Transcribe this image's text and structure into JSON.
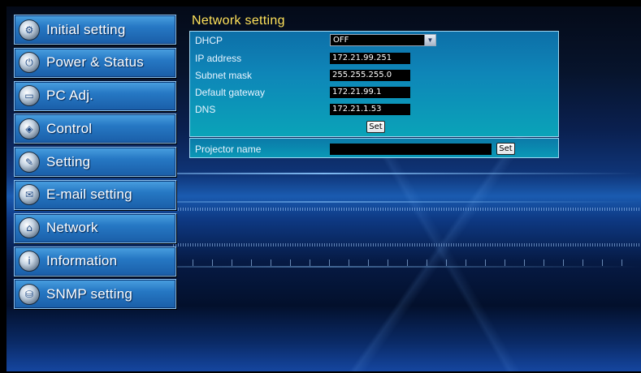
{
  "sidebar": {
    "items": [
      {
        "label": "Initial setting",
        "icon": "initial-setting-icon"
      },
      {
        "label": "Power & Status",
        "icon": "power-status-icon"
      },
      {
        "label": "PC Adj.",
        "icon": "pc-adj-icon"
      },
      {
        "label": "Control",
        "icon": "control-icon"
      },
      {
        "label": "Setting",
        "icon": "setting-icon"
      },
      {
        "label": "E-mail setting",
        "icon": "email-icon"
      },
      {
        "label": "Network",
        "icon": "network-icon"
      },
      {
        "label": "Information",
        "icon": "information-icon"
      },
      {
        "label": "SNMP setting",
        "icon": "snmp-icon"
      }
    ]
  },
  "main": {
    "title": "Network setting",
    "dhcp": {
      "label": "DHCP",
      "value": "OFF"
    },
    "ip": {
      "label": "IP address",
      "value": "172.21.99.251"
    },
    "subnet": {
      "label": "Subnet mask",
      "value": "255.255.255.0"
    },
    "gateway": {
      "label": "Default gateway",
      "value": "172.21.99.1"
    },
    "dns": {
      "label": "DNS",
      "value": "172.21.1.53"
    },
    "set_label": "Set",
    "projector_name": {
      "label": "Projector name",
      "value": "",
      "set_label": "Set"
    }
  },
  "colors": {
    "title": "#ffe25a",
    "panel": "#0e86b8",
    "nav_button": "#2678c4"
  }
}
